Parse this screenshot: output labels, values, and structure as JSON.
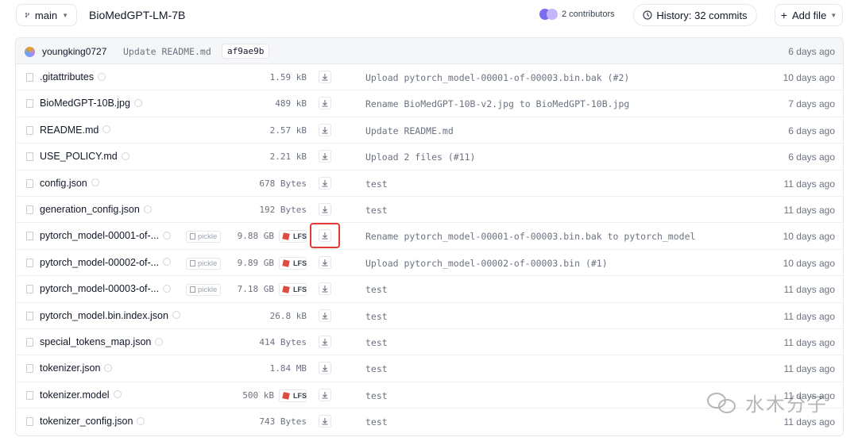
{
  "toolbar": {
    "branch": "main",
    "repo_path": "BioMedGPT-LM-7B",
    "contributors": "2 contributors",
    "history": "History: 32 commits",
    "add_file": "Add file"
  },
  "last_commit": {
    "author": "youngking0727",
    "message": "Update README.md",
    "hash": "af9ae9b",
    "time": "6 days ago"
  },
  "files": [
    {
      "name": ".gitattributes",
      "size": "1.59 kB",
      "lfs": false,
      "pickle": false,
      "message": "Upload pytorch_model-00001-of-00003.bin.bak (#2)",
      "time": "10 days ago"
    },
    {
      "name": "BioMedGPT-10B.jpg",
      "size": "489 kB",
      "lfs": false,
      "pickle": false,
      "message": "Rename BioMedGPT-10B-v2.jpg to BioMedGPT-10B.jpg",
      "time": "7 days ago"
    },
    {
      "name": "README.md",
      "size": "2.57 kB",
      "lfs": false,
      "pickle": false,
      "message": "Update README.md",
      "time": "6 days ago"
    },
    {
      "name": "USE_POLICY.md",
      "size": "2.21 kB",
      "lfs": false,
      "pickle": false,
      "message": "Upload 2 files (#11)",
      "time": "6 days ago"
    },
    {
      "name": "config.json",
      "size": "678 Bytes",
      "lfs": false,
      "pickle": false,
      "message": "test",
      "time": "11 days ago"
    },
    {
      "name": "generation_config.json",
      "size": "192 Bytes",
      "lfs": false,
      "pickle": false,
      "message": "test",
      "time": "11 days ago"
    },
    {
      "name": "pytorch_model-00001-of-...",
      "size": "9.88 GB",
      "lfs": true,
      "pickle": true,
      "pickle_label": "pickle",
      "lfs_label": "LFS",
      "message": "Rename pytorch_model-00001-of-00003.bin.bak to pytorch_model",
      "time": "10 days ago",
      "highlight": true
    },
    {
      "name": "pytorch_model-00002-of-...",
      "size": "9.89 GB",
      "lfs": true,
      "pickle": true,
      "pickle_label": "pickle",
      "lfs_label": "LFS",
      "message": "Upload pytorch_model-00002-of-00003.bin (#1)",
      "time": "10 days ago"
    },
    {
      "name": "pytorch_model-00003-of-...",
      "size": "7.18 GB",
      "lfs": true,
      "pickle": true,
      "pickle_label": "pickle",
      "lfs_label": "LFS",
      "message": "test",
      "time": "11 days ago"
    },
    {
      "name": "pytorch_model.bin.index.json",
      "size": "26.8 kB",
      "lfs": false,
      "pickle": false,
      "message": "test",
      "time": "11 days ago"
    },
    {
      "name": "special_tokens_map.json",
      "size": "414 Bytes",
      "lfs": false,
      "pickle": false,
      "message": "test",
      "time": "11 days ago"
    },
    {
      "name": "tokenizer.json",
      "size": "1.84 MB",
      "lfs": false,
      "pickle": false,
      "message": "test",
      "time": "11 days ago"
    },
    {
      "name": "tokenizer.model",
      "size": "500 kB",
      "lfs": true,
      "pickle": false,
      "lfs_label": "LFS",
      "message": "test",
      "time": "11 days ago"
    },
    {
      "name": "tokenizer_config.json",
      "size": "743 Bytes",
      "lfs": false,
      "pickle": false,
      "message": "test",
      "time": "11 days ago"
    }
  ],
  "watermark": {
    "text": "水木分子"
  },
  "icons": {
    "branch": "branch-icon",
    "history": "clock-icon",
    "download": "download-icon",
    "file": "file-icon",
    "info": "info-icon",
    "lfs": "lfs-cube-icon",
    "pickle": "pickle-icon"
  },
  "colors": {
    "highlight_border": "#e53935",
    "lfs_cube": "#dc4c3f",
    "muted_text": "#6b7280"
  }
}
